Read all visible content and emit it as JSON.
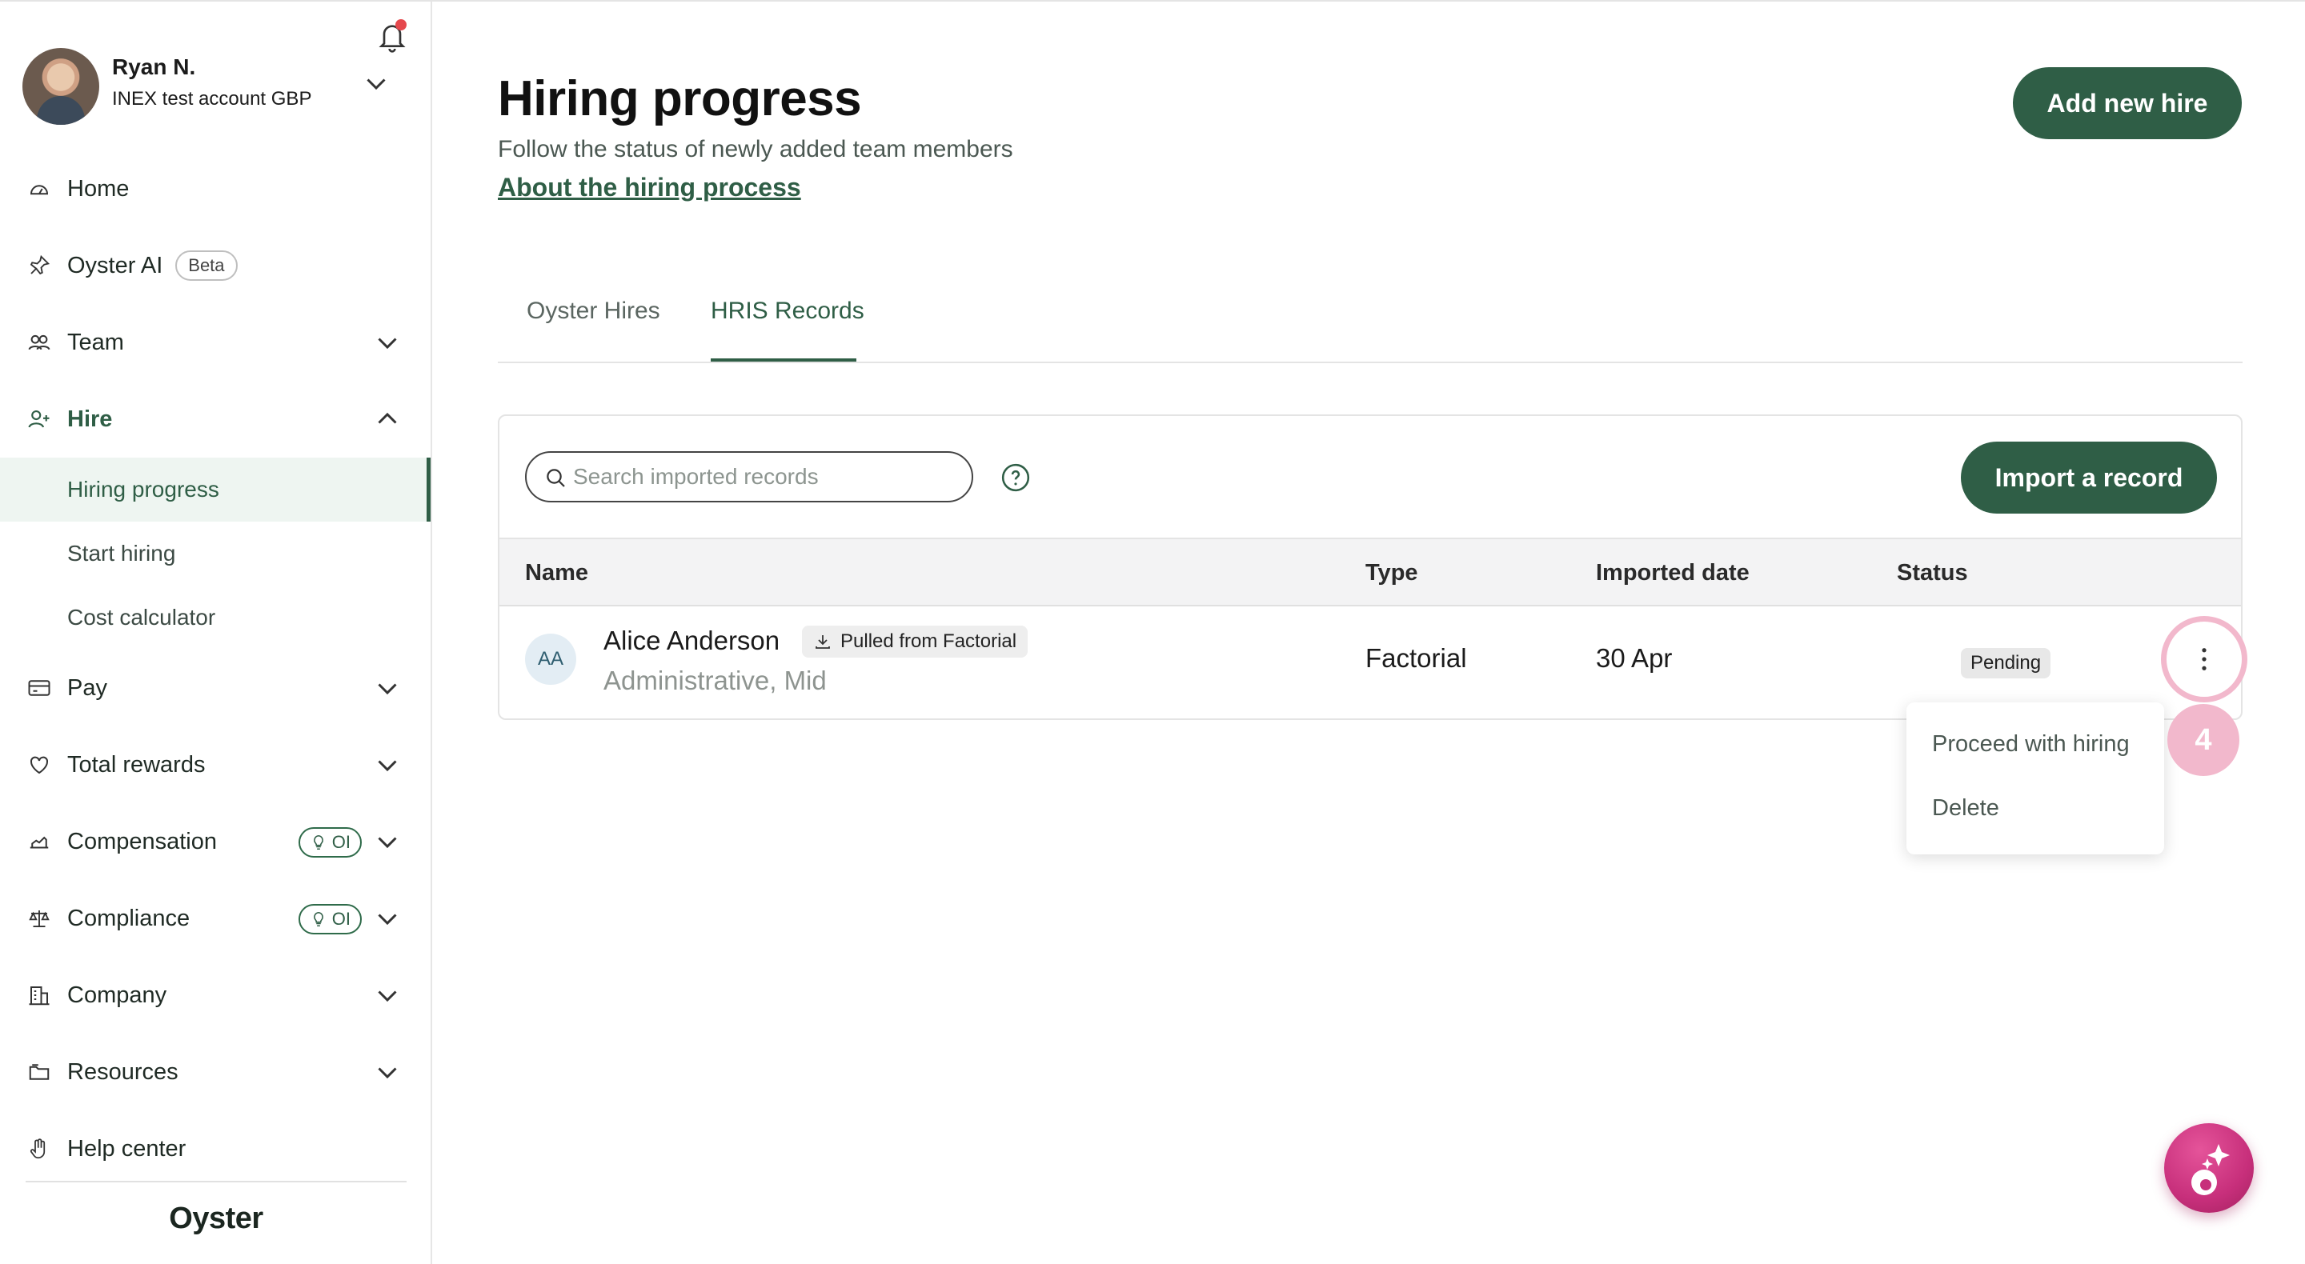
{
  "user": {
    "name": "Ryan N.",
    "account": "INEX test account GBP"
  },
  "nav": {
    "home": "Home",
    "oyster_ai": "Oyster AI",
    "beta": "Beta",
    "team": "Team",
    "hire": "Hire",
    "hiring_progress": "Hiring progress",
    "start_hiring": "Start hiring",
    "cost_calculator": "Cost calculator",
    "pay": "Pay",
    "total_rewards": "Total rewards",
    "compensation": "Compensation",
    "compliance": "Compliance",
    "oi_badge": "OI",
    "company": "Company",
    "resources": "Resources",
    "help_center": "Help center"
  },
  "logo": "Oyster",
  "page": {
    "title": "Hiring progress",
    "subtitle": "Follow the status of newly added team members",
    "about_link": "About the hiring process",
    "add_button": "Add new hire"
  },
  "tabs": [
    "Oyster Hires",
    "HRIS Records"
  ],
  "active_tab": "HRIS Records",
  "records": {
    "search_placeholder": "Search imported records",
    "import_button": "Import a record",
    "columns": [
      "Name",
      "Type",
      "Imported date",
      "Status"
    ],
    "rows": [
      {
        "initials": "AA",
        "name": "Alice Anderson",
        "source_badge": "Pulled from Factorial",
        "role": "Administrative, Mid",
        "type": "Factorial",
        "imported_date": "30 Apr",
        "status": "Pending"
      }
    ]
  },
  "row_menu": {
    "items": [
      "Proceed with hiring",
      "Delete"
    ]
  },
  "step_badge": "4",
  "colors": {
    "brand": "#2f5e46",
    "highlight": "#f2b8cc",
    "ai_fab": "#c72f7b"
  }
}
